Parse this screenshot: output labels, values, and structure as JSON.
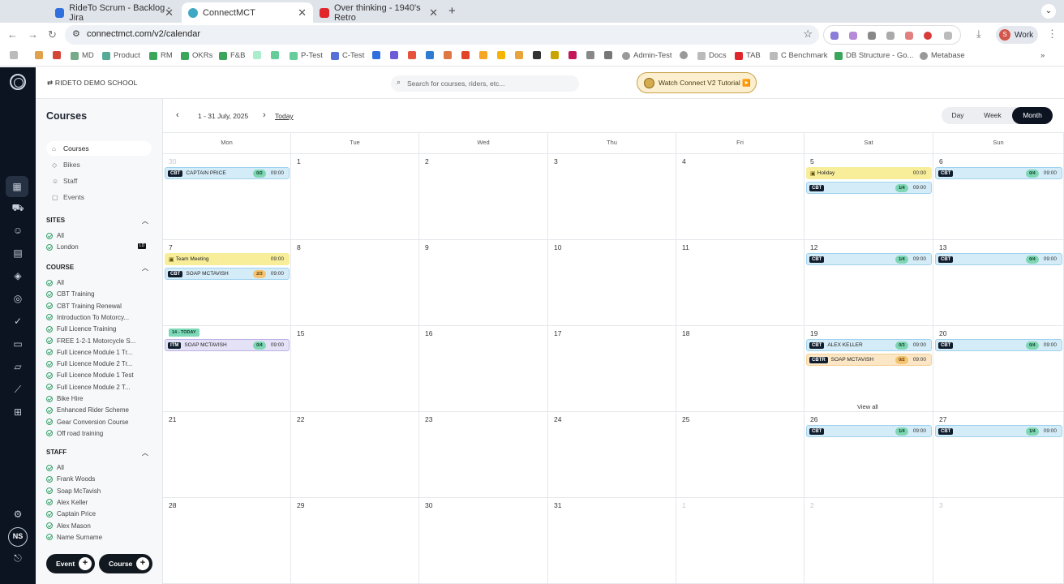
{
  "browser": {
    "tabs": [
      {
        "title": "RideTo Scrum - Backlog - Jira",
        "color": "#2f6fde"
      },
      {
        "title": "ConnectMCT",
        "color": "#40a7c4"
      },
      {
        "title": "Over thinking - 1940's Retro",
        "color": "#e0262b"
      }
    ],
    "url": "connectmct.com/v2/calendar",
    "profile": "Work",
    "profile_initial": "S",
    "bookmarks": [
      "MD",
      "Product",
      "RM",
      "OKRs",
      "F&B",
      "P-Test",
      "C-Test",
      "Admin-Test",
      "Docs",
      "TAB",
      "C Benchmark",
      "DB Structure - Go...",
      "Metabase"
    ]
  },
  "app": {
    "school": "RIDETO DEMO SCHOOL",
    "search_placeholder": "Search for courses, riders, etc...",
    "tutorial_label": "Watch Connect V2 Tutorial ▶️",
    "user_initials": "NS"
  },
  "sidebar": {
    "title": "Courses",
    "nav": [
      "Courses",
      "Bikes",
      "Staff",
      "Events"
    ],
    "sites_title": "SITES",
    "sites": [
      "All",
      "London"
    ],
    "site_badge": "LD",
    "course_title": "COURSE",
    "courses": [
      "All",
      "CBT Training",
      "CBT Training Renewal",
      "Introduction To Motorcy...",
      "Full Licence Training",
      "FREE 1-2-1 Motorcycle S...",
      "Full Licence Module 1 Tr...",
      "Full Licence Module 2 Tr...",
      "Full Licence Module 1 Test",
      "Full Licence Module 2 T...",
      "Bike Hire",
      "Enhanced Rider Scheme",
      "Gear Conversion Course",
      "Off road training"
    ],
    "staff_title": "STAFF",
    "staff": [
      "All",
      "Frank Woods",
      "Soap McTavish",
      "Alex Keller",
      "Captain Price",
      "Alex Mason",
      "Name Surname"
    ],
    "event_btn": "Event",
    "course_btn": "Course"
  },
  "calendar": {
    "range": "1 - 31 July, 2025",
    "today_label": "Today",
    "views": [
      "Day",
      "Week",
      "Month"
    ],
    "active_view": "Month",
    "weekdays": [
      "Mon",
      "Tue",
      "Wed",
      "Thu",
      "Fri",
      "Sat",
      "Sun"
    ],
    "weeks": [
      [
        "30",
        "1",
        "2",
        "3",
        "4",
        "5",
        "6"
      ],
      [
        "7",
        "8",
        "9",
        "10",
        "11",
        "12",
        "13"
      ],
      [
        "14 - TODAY",
        "15",
        "16",
        "17",
        "18",
        "19",
        "20"
      ],
      [
        "21",
        "22",
        "23",
        "24",
        "25",
        "26",
        "27"
      ],
      [
        "28",
        "29",
        "30",
        "31",
        "1",
        "2",
        "3"
      ]
    ],
    "muted": [
      "0-0",
      "4-4",
      "4-5",
      "4-6"
    ],
    "view_all": "View all",
    "events": [
      {
        "w": 0,
        "d": 0,
        "row": 0,
        "kind": "blue",
        "tag": "CBT",
        "name": "CAPTAIN PRICE",
        "count": "0/2",
        "count_color": "green",
        "time": "09:00"
      },
      {
        "w": 0,
        "d": 5,
        "row": 0,
        "kind": "yellow",
        "icon": "📅",
        "name": "Holiday",
        "time": "00:00"
      },
      {
        "w": 0,
        "d": 5,
        "row": 1,
        "kind": "blue",
        "tag": "CBT",
        "name": "",
        "count": "1/4",
        "count_color": "green",
        "time": "09:00"
      },
      {
        "w": 0,
        "d": 6,
        "row": 0,
        "kind": "blue",
        "tag": "CBT",
        "name": "",
        "count": "0/4",
        "count_color": "green",
        "time": "09:00"
      },
      {
        "w": 1,
        "d": 0,
        "row": 0,
        "kind": "yellow",
        "icon": "📅",
        "name": "Team Meeting",
        "time": "09:00"
      },
      {
        "w": 1,
        "d": 0,
        "row": 1,
        "kind": "blue",
        "tag": "CBT",
        "name": "SOAP MCTAVISH",
        "count": "2/3",
        "count_color": "amber",
        "time": "09:00"
      },
      {
        "w": 1,
        "d": 5,
        "row": 0,
        "kind": "blue",
        "tag": "CBT",
        "name": "",
        "count": "1/4",
        "count_color": "green",
        "time": "09:00"
      },
      {
        "w": 1,
        "d": 6,
        "row": 0,
        "kind": "blue",
        "tag": "CBT",
        "name": "",
        "count": "0/4",
        "count_color": "green",
        "time": "09:00"
      },
      {
        "w": 2,
        "d": 0,
        "row": 0,
        "kind": "lav",
        "tag": "ITM",
        "name": "SOAP MCTAVISH",
        "count": "0/4",
        "count_color": "green",
        "time": "09:00"
      },
      {
        "w": 2,
        "d": 5,
        "row": 0,
        "kind": "blue",
        "tag": "CBT",
        "name": "ALEX KELLER",
        "count": "0/3",
        "count_color": "green",
        "time": "09:00"
      },
      {
        "w": 2,
        "d": 5,
        "row": 1,
        "kind": "orange",
        "tag": "CBTR",
        "name": "SOAP MCTAVISH",
        "count": "0/2",
        "count_color": "amber",
        "time": "09:00"
      },
      {
        "w": 2,
        "d": 6,
        "row": 0,
        "kind": "blue",
        "tag": "CBT",
        "name": "",
        "count": "0/4",
        "count_color": "green",
        "time": "09:00"
      },
      {
        "w": 3,
        "d": 5,
        "row": 0,
        "kind": "blue",
        "tag": "CBT",
        "name": "",
        "count": "1/4",
        "count_color": "green",
        "time": "09:00"
      },
      {
        "w": 3,
        "d": 6,
        "row": 0,
        "kind": "blue",
        "tag": "CBT",
        "name": "",
        "count": "1/4",
        "count_color": "green",
        "time": "09:00"
      }
    ]
  }
}
